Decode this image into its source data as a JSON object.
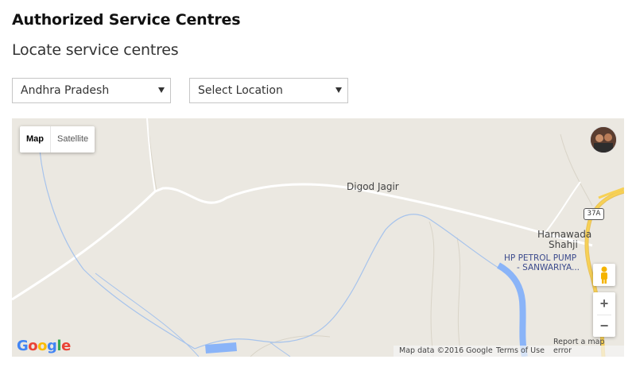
{
  "page": {
    "title": "Authorized Service Centres",
    "subtitle": "Locate service centres"
  },
  "filters": {
    "state_value": "Andhra Pradesh",
    "location_value": "Select Location"
  },
  "map": {
    "type_buttons": {
      "map": "Map",
      "satellite": "Satellite"
    },
    "labels": {
      "digod": "Digod Jagir",
      "harnawada_line1": "Harnawada",
      "harnawada_line2": "Shahji",
      "poi_line1": "HP PETROL PUMP",
      "poi_line2": "- SANWARIYA...",
      "road_shield": "37A"
    },
    "zoom_in": "+",
    "zoom_out": "−",
    "footer": {
      "map_data": "Map data ©2016 Google",
      "terms": "Terms of Use",
      "report": "Report a map error"
    },
    "colors": {
      "land": "#ebe8e1",
      "water": "#8ab4f8",
      "highway": "#f7d155",
      "road": "#ffffff"
    }
  }
}
